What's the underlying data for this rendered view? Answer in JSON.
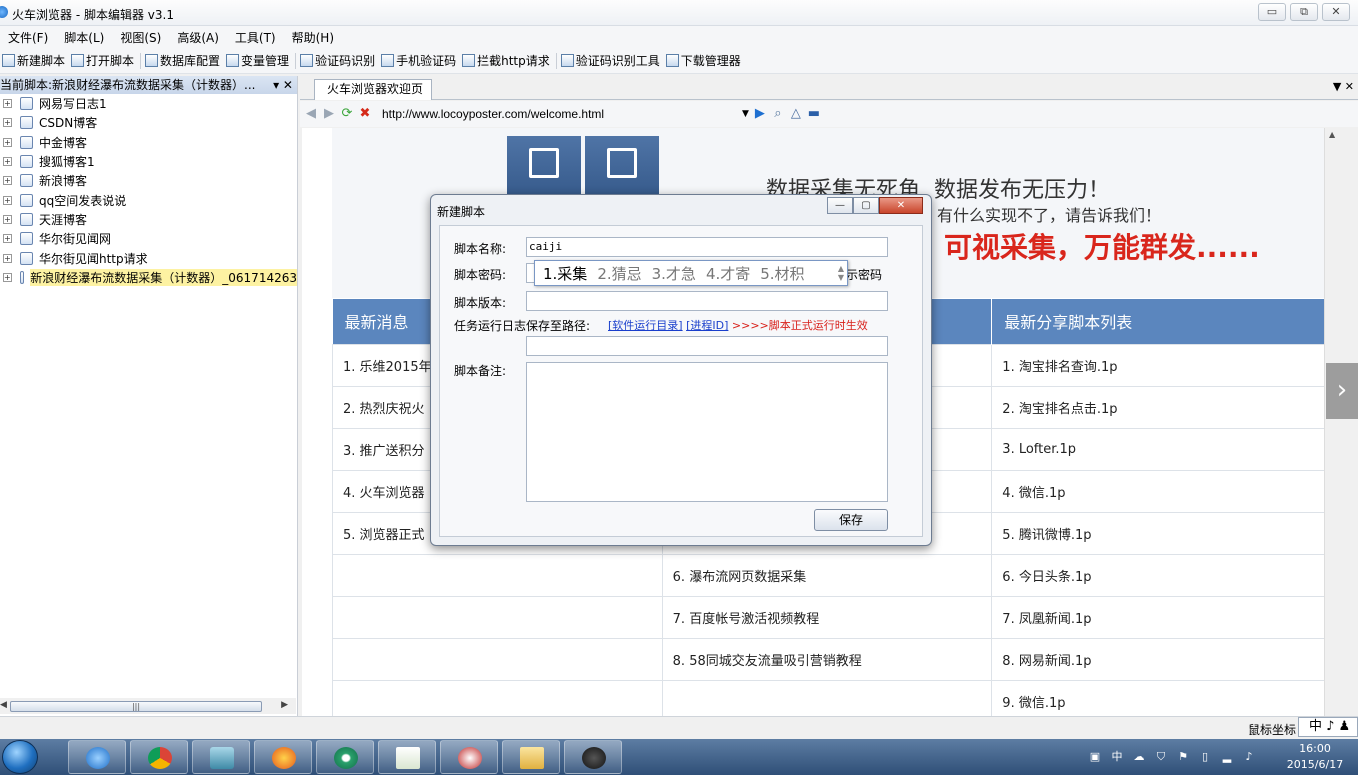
{
  "window": {
    "title": "火车浏览器 - 脚本编辑器 v3.1",
    "controls": [
      "▭",
      "⧉",
      "✕"
    ]
  },
  "menu": [
    "文件(F)",
    "脚本(L)",
    "视图(S)",
    "高级(A)",
    "工具(T)",
    "帮助(H)"
  ],
  "toolbar": [
    "新建脚本",
    "打开脚本",
    "数据库配置",
    "变量管理",
    "验证码识别",
    "手机验证码",
    "拦截http请求",
    "验证码识别工具",
    "下载管理器"
  ],
  "left_panel": {
    "header": "当前脚本:新浪财经瀑布流数据采集（计数器）...",
    "header_buttons": "▾ ✕",
    "tree": [
      {
        "label": "网易写日志1",
        "selected": false
      },
      {
        "label": "CSDN博客",
        "selected": false
      },
      {
        "label": "中金博客",
        "selected": false
      },
      {
        "label": "搜狐博客1",
        "selected": false
      },
      {
        "label": "新浪博客",
        "selected": false
      },
      {
        "label": "qq空间发表说说",
        "selected": false
      },
      {
        "label": "天涯博客",
        "selected": false
      },
      {
        "label": "华尔街见闻网",
        "selected": false
      },
      {
        "label": "华尔街见闻http请求",
        "selected": false
      },
      {
        "label": "新浪财经瀑布流数据采集（计数器）_061714263",
        "selected": true
      }
    ],
    "expander": "+",
    "hscroll_thumb": "|||"
  },
  "browser": {
    "tab": "火车浏览器欢迎页",
    "url": "http://www.locoyposter.com/welcome.html"
  },
  "webpage": {
    "headline": "数据采集无死角, 数据发布无压力！",
    "subline": "有什么实现不了，请告诉我们！",
    "slogan": "可视采集，万能群发......",
    "col1_header": "最新消息",
    "col3_header": "最新分享脚本列表",
    "rows": [
      {
        "c1": "1. 乐维2015年",
        "c2": "",
        "c3": "1. 淘宝排名查询.1p"
      },
      {
        "c1": "2. 热烈庆祝火",
        "c2": "",
        "c3": "2. 淘宝排名点击.1p"
      },
      {
        "c1": "3. 推广送积分",
        "c2": "",
        "c3": "3. Lofter.1p"
      },
      {
        "c1": "4. 火车浏览器",
        "c2": "",
        "c3": "4. 微信.1p"
      },
      {
        "c1": "5. 浏览器正式",
        "c2": "",
        "c3": "5. 腾讯微博.1p"
      },
      {
        "c1": "",
        "c2": "6. 瀑布流网页数据采集",
        "c3": "6. 今日头条.1p"
      },
      {
        "c1": "",
        "c2": "7. 百度帐号激活视频教程",
        "c3": "7. 凤凰新闻.1p"
      },
      {
        "c1": "",
        "c2": "8. 58同城交友流量吸引营销教程",
        "c3": "8. 网易新闻.1p"
      },
      {
        "c1": "",
        "c2": "",
        "c3": "9. 微信.1p"
      }
    ]
  },
  "dialog": {
    "title": "新建脚本",
    "name_label": "脚本名称:",
    "name_value": "caiji",
    "password_label": "脚本密码:",
    "show_password": "示密码",
    "version_label": "脚本版本:",
    "log_label": "任务运行日志保存至路径:",
    "link_software": "[软件运行目录]",
    "link_process": "[进程ID]",
    "log_note": ">>>>脚本正式运行时生效",
    "remark_label": "脚本备注:",
    "save_button": "保存"
  },
  "ime": {
    "candidates": [
      "1.采集",
      "2.猜忌",
      "3.才急",
      "4.才寄",
      "5.材积"
    ]
  },
  "statusbar": {
    "mouse": "鼠标坐标",
    "ime_indicator": "中 ♪ ♟"
  },
  "taskbar": {
    "time": "16:00",
    "date": "2015/6/17",
    "tray_ime": "中"
  },
  "colors": {
    "table_header": "#5b86be",
    "slogan_red": "#d9261c",
    "link_blue": "#1a3fcc",
    "selected_highlight": "#fdf2a2"
  }
}
